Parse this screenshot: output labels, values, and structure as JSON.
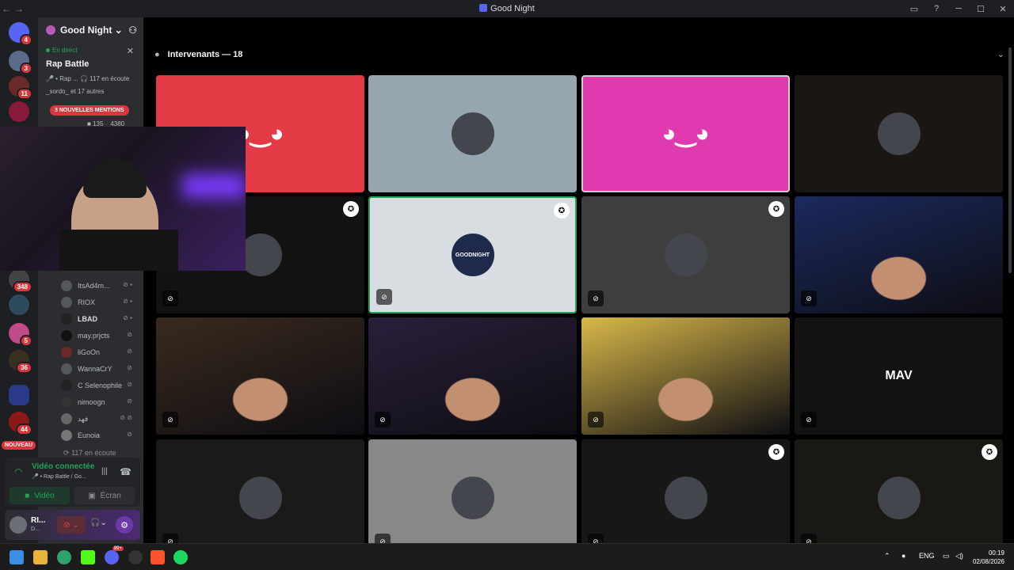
{
  "window": {
    "title": "Good Night"
  },
  "server": {
    "name": "Good Night"
  },
  "live_label": "En direct",
  "stage": {
    "name": "Rap Battle",
    "meta": "🎤 • Rap ... 🎧 117 en écoute",
    "participants": "_sordo_ et 17 autres"
  },
  "mentions_banner": "3 NOUVELLES MENTIONS",
  "channel_row": {
    "video": "135",
    "count": "4380"
  },
  "guild_badges": [
    "4",
    "3",
    "11",
    "348",
    "5",
    "36",
    "44"
  ],
  "new_label": "NOUVEAU",
  "members": [
    {
      "name": "ItsAd4m..."
    },
    {
      "name": "RIOX"
    },
    {
      "name": "LBAD"
    },
    {
      "name": "may.prjcts"
    },
    {
      "name": "liGoOn"
    },
    {
      "name": "WannaCrY"
    },
    {
      "name": "C Selenophile"
    },
    {
      "name": "nimoogn"
    },
    {
      "name": "فهد"
    },
    {
      "name": "Eunoia"
    }
  ],
  "listening": "117 en écoute",
  "voice": {
    "status": "Vidéo connectée",
    "sub": "🎤 • Rap Battle / Go...",
    "video_label": "Vidéo",
    "screen_label": "Écran"
  },
  "user": {
    "name": "RI...",
    "status": "D..."
  },
  "speakers_header": "Intervenants — 18",
  "tiles": [
    {
      "type": "discord",
      "bg": "#e23b46"
    },
    {
      "type": "avatar",
      "bg": "#95a6ae"
    },
    {
      "type": "discord",
      "bg": "#e03aaf"
    },
    {
      "type": "avatar",
      "bg": "#1a1614"
    },
    {
      "type": "avatar",
      "bg": "#121212",
      "mod": true
    },
    {
      "type": "avatar",
      "bg": "#d8dde2",
      "mod": true,
      "label": "GOODNIGHT"
    },
    {
      "type": "avatar",
      "bg": "#3e3e3e",
      "mod": true
    },
    {
      "type": "camera",
      "bg": "#1b2a5e"
    },
    {
      "type": "camera",
      "bg": "#3a2a1e"
    },
    {
      "type": "camera",
      "bg": "#2a1f3a"
    },
    {
      "type": "camera",
      "bg": "#d9b84a"
    },
    {
      "type": "avatar",
      "bg": "#131313",
      "label": "MAV"
    },
    {
      "type": "avatar",
      "bg": "#1a1a1a"
    },
    {
      "type": "avatar",
      "bg": "#888888"
    },
    {
      "type": "avatar",
      "bg": "#171717",
      "mod": true
    },
    {
      "type": "avatar",
      "bg": "#1a1814",
      "mod": true
    }
  ],
  "taskbar": {
    "lang": "ENG",
    "time": "00:19",
    "date": "02/08/2026",
    "notif": "99+"
  }
}
